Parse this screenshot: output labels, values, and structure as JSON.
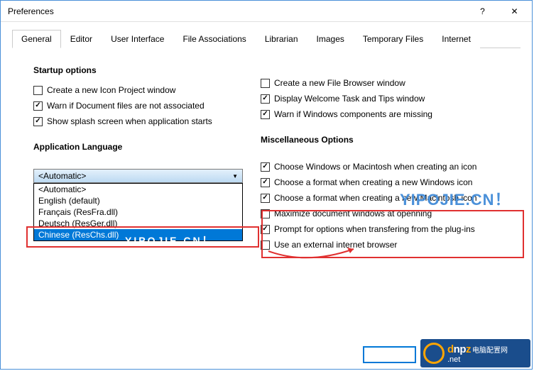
{
  "titlebar": {
    "title": "Preferences"
  },
  "tabs": [
    "General",
    "Editor",
    "User Interface",
    "File Associations",
    "Librarian",
    "Images",
    "Temporary Files",
    "Internet"
  ],
  "startup": {
    "title": "Startup options",
    "left": [
      {
        "label": "Create a new Icon Project window",
        "checked": false
      },
      {
        "label": "Warn if Document files are not associated",
        "checked": true
      },
      {
        "label": "Show splash screen when application starts",
        "checked": true
      }
    ],
    "right": [
      {
        "label": "Create a new File Browser window",
        "checked": false
      },
      {
        "label": "Display Welcome Task and Tips window",
        "checked": true
      },
      {
        "label": "Warn if Windows components are missing",
        "checked": true
      }
    ]
  },
  "lang": {
    "title": "Application Language",
    "selected": "<Automatic>",
    "options": [
      "<Automatic>",
      "English (default)",
      "Français (ResFra.dll)",
      "Deutsch (ResGer.dll)",
      "Chinese (ResChs.dll)"
    ]
  },
  "misc": {
    "title": "Miscellaneous Options",
    "items": [
      {
        "label": "Choose Windows or Macintosh when creating an icon",
        "checked": true
      },
      {
        "label": "Choose a format when creating a new Windows icon",
        "checked": true
      },
      {
        "label": "Choose a format when creating a new Macintosh icon",
        "checked": true
      },
      {
        "label": "Maximize document windows at openning",
        "checked": false
      },
      {
        "label": "Prompt for options when transfering from the plug-ins",
        "checked": true
      },
      {
        "label": "Use an external internet browser",
        "checked": false
      }
    ]
  },
  "footer": {
    "ok": "",
    "cancel": ""
  },
  "watermarks": {
    "w1": "YIPOJIE.CN！",
    "w2": "YIPOJIE.CN！"
  },
  "logo": {
    "main": "dnpz",
    "cn": "电脑配置网",
    "sub": ".net"
  }
}
